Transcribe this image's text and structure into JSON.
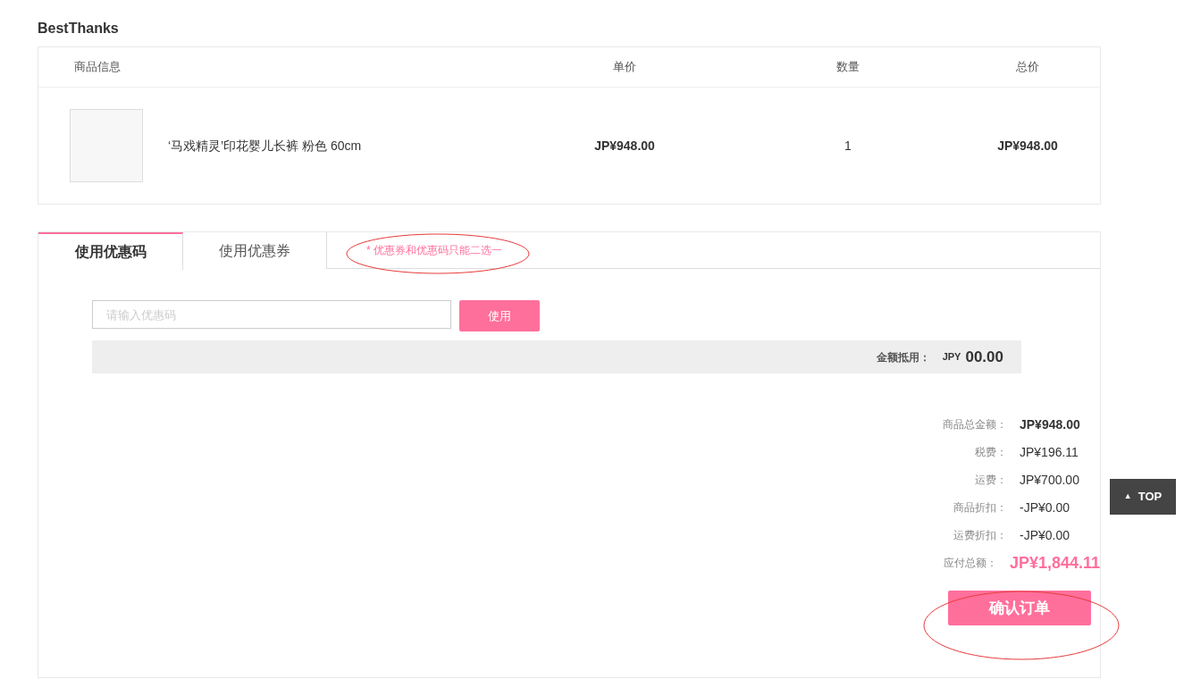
{
  "shop_name": "BestThanks",
  "table": {
    "columns": [
      "商品信息",
      "单价",
      "数量",
      "总价"
    ],
    "rows": [
      {
        "product_name": "‘马戏精灵’印花婴儿长裤 粉色 60cm",
        "unit_price": "JP¥948.00",
        "quantity": "1",
        "total": "JP¥948.00"
      }
    ]
  },
  "tabs": [
    {
      "label": "使用优惠码",
      "selected": true
    },
    {
      "label": "使用优惠券",
      "selected": false
    }
  ],
  "tab_hint": "* 优惠券和优惠码只能二选一",
  "coupon": {
    "placeholder": "请输入优惠码",
    "button": "使用",
    "discount_label": "金额抵用：",
    "discount_currency": "JPY",
    "discount_amount": "00.00"
  },
  "summary": [
    {
      "label": "商品总金额：",
      "value": "JP¥948.00",
      "kind": "bold"
    },
    {
      "label": "税费：",
      "value": "JP¥196.11",
      "kind": "plain"
    },
    {
      "label": "运费：",
      "value": "JP¥700.00",
      "kind": "plain"
    },
    {
      "label": "商品折扣：",
      "value": "-JP¥0.00",
      "kind": "plain"
    },
    {
      "label": "运费折扣：",
      "value": "-JP¥0.00",
      "kind": "plain"
    },
    {
      "label": "应付总额：",
      "value": "JP¥1,844.11",
      "kind": "total"
    }
  ],
  "confirm_button": "确认订单",
  "back_to_top": {
    "icon": "▲",
    "label": "TOP"
  }
}
